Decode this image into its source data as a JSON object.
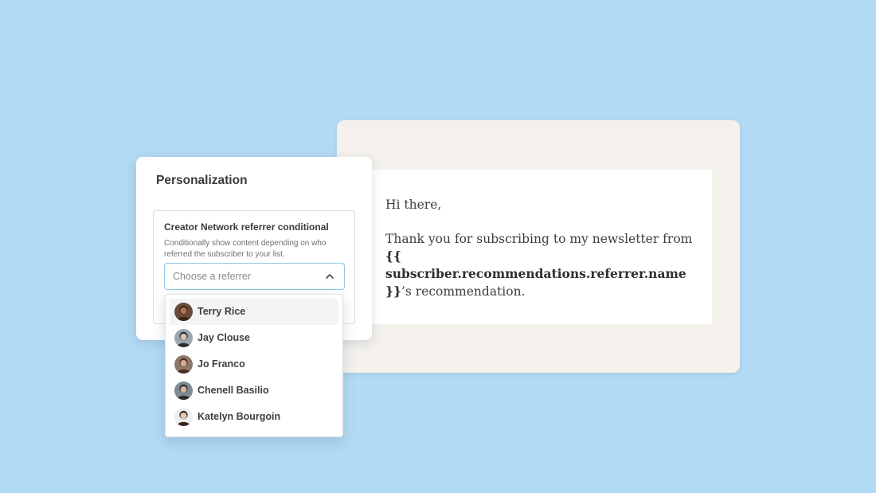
{
  "email": {
    "greeting": "Hi there,",
    "text_before": "Thank you for subscribing to my newsletter from ",
    "merge_tag": "{{ subscriber.recommendations.referrer.name }}",
    "text_after": "’s recommendation."
  },
  "panel": {
    "title": "Personalization",
    "block": {
      "title": "Creator Network referrer conditional",
      "description": "Conditionally show content depending on who referred the subscriber to your list.",
      "select_placeholder": "Choose a referrer"
    }
  },
  "dropdown": {
    "options": [
      {
        "label": "Terry Rice",
        "active": true,
        "skin": "#b0714f",
        "hair": "#3b2418",
        "bg": "#6a4a3c"
      },
      {
        "label": "Jay Clouse",
        "active": false,
        "skin": "#d9c3b2",
        "hair": "#2b2b2b",
        "bg": "#9aa7b0"
      },
      {
        "label": "Jo Franco",
        "active": false,
        "skin": "#d7a98d",
        "hair": "#4a2e20",
        "bg": "#8b7a6a"
      },
      {
        "label": "Chenell Basilio",
        "active": false,
        "skin": "#cfb3a3",
        "hair": "#2f2a2a",
        "bg": "#7d8b93"
      },
      {
        "label": "Katelyn Bourgoin",
        "active": false,
        "skin": "#e3c8b8",
        "hair": "#3a2620",
        "bg": "#eeeeee"
      }
    ]
  }
}
